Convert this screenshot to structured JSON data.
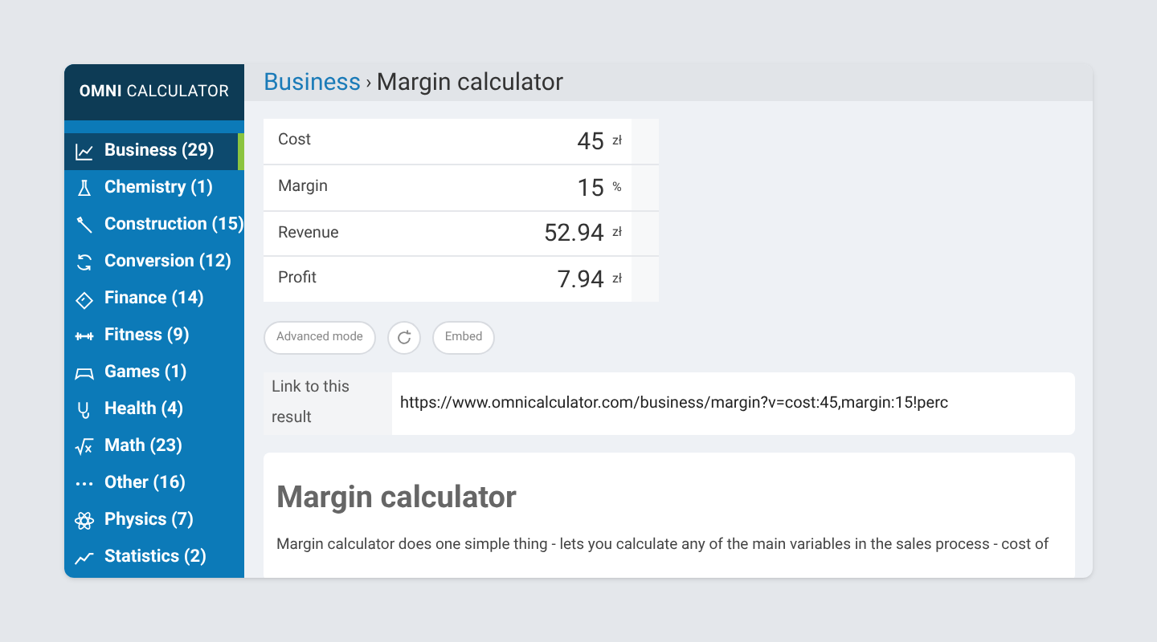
{
  "logo": "**OMNI** CALCULATOR",
  "sidebar": {
    "items": [
      {
        "label": "Business (29)",
        "selected": true
      },
      {
        "label": "Chemistry (1)",
        "selected": false
      },
      {
        "label": "Construction (15)",
        "selected": false
      },
      {
        "label": "Conversion (12)",
        "selected": false
      },
      {
        "label": "Finance (14)",
        "selected": false
      },
      {
        "label": "Fitness (9)",
        "selected": false
      },
      {
        "label": "Games (1)",
        "selected": false
      },
      {
        "label": "Health (4)",
        "selected": false
      },
      {
        "label": "Math (23)",
        "selected": false
      },
      {
        "label": "Other (16)",
        "selected": false
      },
      {
        "label": "Physics (7)",
        "selected": false
      },
      {
        "label": "Statistics (2)",
        "selected": false
      }
    ]
  },
  "breadcrumb": {
    "parent": "Business",
    "separator": "›",
    "current": "Margin calculator"
  },
  "calculator": {
    "rows": [
      {
        "label": "Cost",
        "value": "45",
        "unit": "zł"
      },
      {
        "label": "Margin",
        "value": "15",
        "unit": "%"
      },
      {
        "label": "Revenue",
        "value": "52.94",
        "unit": "zł"
      },
      {
        "label": "Profit",
        "value": "7.94",
        "unit": "zł"
      }
    ]
  },
  "buttons": [
    {
      "kind": "text",
      "label": "Advanced mode"
    },
    {
      "kind": "reload"
    },
    {
      "kind": "text",
      "label": "Embed"
    }
  ],
  "link": {
    "label": "Link to this result",
    "url": "https://www.omnicalculator.com/business/margin?v=cost:45,margin:15!perc"
  },
  "article": {
    "title": "Margin calculator",
    "text": "Margin calculator does one simple thing - lets you calculate any of the main variables in the sales process - cost of"
  }
}
